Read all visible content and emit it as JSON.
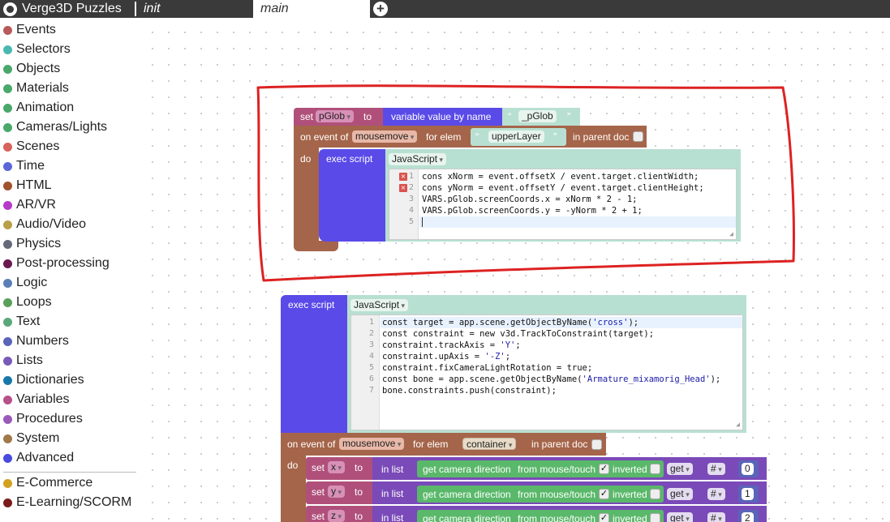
{
  "app": {
    "title": "Verge3D Puzzles"
  },
  "tabs": [
    {
      "label": "init"
    },
    {
      "label": "main"
    }
  ],
  "add_tab": "+",
  "sidebar": {
    "categories": [
      {
        "label": "Events",
        "color": "#b85a5a"
      },
      {
        "label": "Selectors",
        "color": "#4bb8b0"
      },
      {
        "label": "Objects",
        "color": "#49a86a"
      },
      {
        "label": "Materials",
        "color": "#49a86a"
      },
      {
        "label": "Animation",
        "color": "#49a86a"
      },
      {
        "label": "Cameras/Lights",
        "color": "#49a86a"
      },
      {
        "label": "Scenes",
        "color": "#d8625c"
      },
      {
        "label": "Time",
        "color": "#5b67d8"
      },
      {
        "label": "HTML",
        "color": "#a0522d"
      },
      {
        "label": "AR/VR",
        "color": "#b43cc8"
      },
      {
        "label": "Audio/Video",
        "color": "#b8a048"
      },
      {
        "label": "Physics",
        "color": "#666a78"
      },
      {
        "label": "Post-processing",
        "color": "#6a1850"
      },
      {
        "label": "Logic",
        "color": "#5a7fb8"
      },
      {
        "label": "Loops",
        "color": "#5aa05a"
      },
      {
        "label": "Text",
        "color": "#5aa87a"
      },
      {
        "label": "Numbers",
        "color": "#5a64b8"
      },
      {
        "label": "Lists",
        "color": "#7a5ab8"
      },
      {
        "label": "Dictionaries",
        "color": "#1878a8"
      },
      {
        "label": "Variables",
        "color": "#b8508a"
      },
      {
        "label": "Procedures",
        "color": "#9a5aba"
      },
      {
        "label": "System",
        "color": "#a0784a"
      },
      {
        "label": "Advanced",
        "color": "#4a4ae0"
      }
    ],
    "extra": [
      {
        "label": "E-Commerce",
        "color": "#d4a020"
      },
      {
        "label": "E-Learning/SCORM",
        "color": "#7a1a1a"
      }
    ]
  },
  "block1": {
    "set": "set",
    "var": "pGlob",
    "to": "to",
    "var_value": "variable value by name",
    "name": "_pGlob",
    "on_event": "on event of",
    "event": "mousemove",
    "for_elem": "for elem",
    "elem": "upperLayer",
    "in_parent": "in parent doc",
    "do": "do",
    "exec": "exec script",
    "lang": "JavaScript",
    "code": [
      "cons xNorm = event.offsetX / event.target.clientWidth;",
      "cons yNorm = event.offsetY / event.target.clientHeight;",
      "VARS.pGlob.screenCoords.x = xNorm * 2 - 1;",
      "VARS.pGlob.screenCoords.y = -yNorm * 2 + 1;",
      ""
    ],
    "line_numbers": [
      "1",
      "2",
      "3",
      "4",
      "5"
    ],
    "error_marks": [
      "×",
      "×"
    ]
  },
  "block2": {
    "exec": "exec script",
    "lang": "JavaScript",
    "code_plain": [
      "const target = app.scene.getObjectByName(",
      "const constraint = new v3d.TrackToConstraint(target);",
      "constraint.trackAxis = ",
      "constraint.upAxis = ",
      "constraint.fixCameraLightRotation = true;",
      "const bone = app.scene.getObjectByName(",
      "bone.constraints.push(constraint);"
    ],
    "code_str": [
      "'cross'",
      "",
      "'Y'",
      "'-Z'",
      "",
      "'Armature_mixamorig_Head'",
      ""
    ],
    "code_tail": [
      ");",
      "",
      ";",
      ";",
      "",
      ");",
      ""
    ],
    "line_numbers": [
      "1",
      "2",
      "3",
      "4",
      "5",
      "6",
      "7"
    ]
  },
  "block3": {
    "on_event": "on event of",
    "event": "mousemove",
    "for_elem": "for elem",
    "elem": "container",
    "in_parent": "in parent doc",
    "do": "do",
    "rows": [
      {
        "set": "set",
        "var": "x",
        "to": "to",
        "in_list": "in list",
        "get_dir": "get camera direction",
        "from": "from mouse/touch",
        "check": "✓",
        "inverted": "inverted",
        "get": "get",
        "hash": "#",
        "index": "0"
      },
      {
        "set": "set",
        "var": "y",
        "to": "to",
        "in_list": "in list",
        "get_dir": "get camera direction",
        "from": "from mouse/touch",
        "check": "✓",
        "inverted": "inverted",
        "get": "get",
        "hash": "#",
        "index": "1"
      },
      {
        "set": "set",
        "var": "z",
        "to": "to",
        "in_list": "in list",
        "get_dir": "get camera direction",
        "from": "from mouse/touch",
        "check": "✓",
        "inverted": "inverted",
        "get": "get",
        "hash": "#",
        "index": "2"
      }
    ]
  },
  "colors": {
    "topbar": "#3a3a3a",
    "event_block": "#a5654a",
    "variable_block": "#b0507a",
    "advanced_block": "#5a4ae8",
    "exec_inner": "#b8e0d2",
    "camera_block": "#5ab86a",
    "list_block": "#7a4ab8",
    "annotation": "#dd2222"
  }
}
